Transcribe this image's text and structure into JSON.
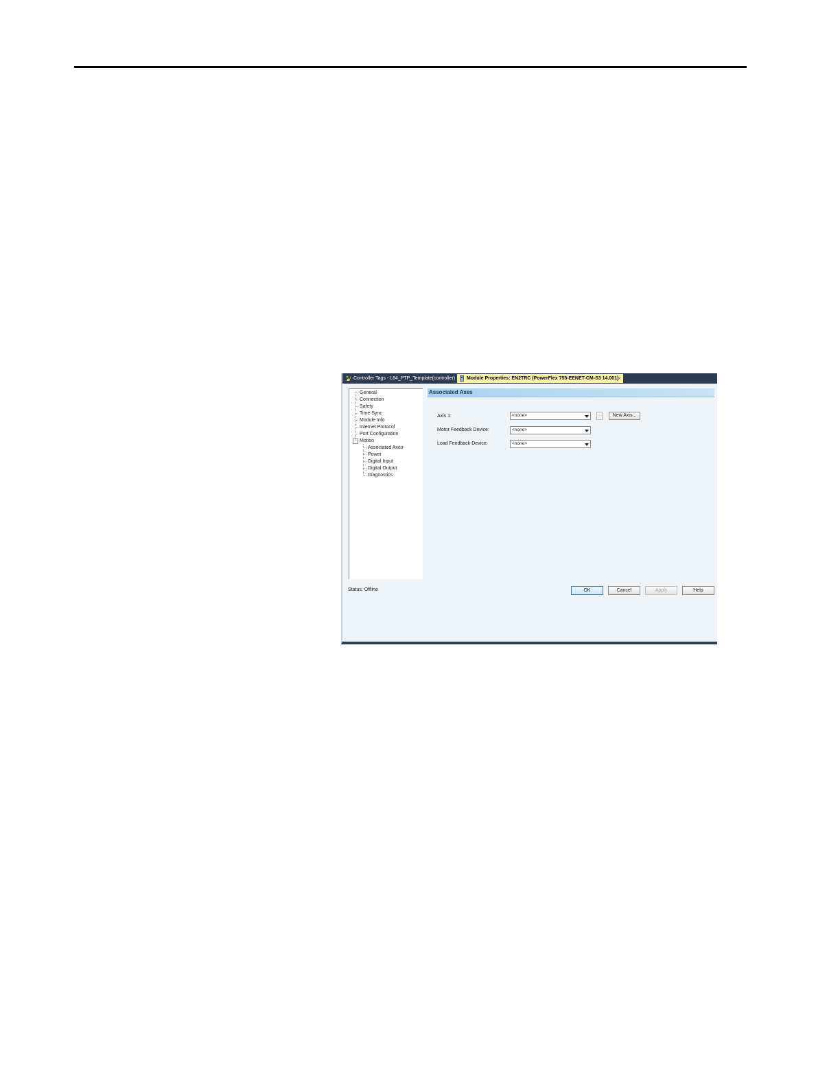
{
  "tabs": [
    {
      "label": "Controller Tags - L84_PTP_Template(controller)",
      "icon": "controller-tags-icon"
    },
    {
      "label": "Module Properties: EN2TRC (PowerFlex 755-EENET-CM-S3 14.001)",
      "icon": "module-icon",
      "close": "×"
    }
  ],
  "tree": {
    "items": [
      "General",
      "Connection",
      "Safety",
      "Time Sync",
      "Module Info",
      "Internet Protocol",
      "Port Configuration",
      "Motion"
    ],
    "expander": "−",
    "motion_children": [
      "Associated Axes",
      "Power",
      "Digital Input",
      "Digital Output",
      "Diagnostics"
    ]
  },
  "panel": {
    "header": "Associated Axes",
    "fields": [
      {
        "label": "Axis 1:",
        "value": "<none>"
      },
      {
        "label": "Motor Feedback Device:",
        "value": "<none>"
      },
      {
        "label": "Load Feedback Device:",
        "value": "<none>"
      }
    ],
    "ellipsis": "...",
    "new_axis": "New Axis..."
  },
  "status": "Status:  Offline",
  "buttons": {
    "ok": "OK",
    "cancel": "Cancel",
    "apply": "Apply",
    "help": "Help"
  },
  "colors": {
    "tabbar": "#2c3b52",
    "active_tab": "#fdf4a8",
    "header_band": "#a9d2ee",
    "window_bg": "#eef4f7"
  }
}
